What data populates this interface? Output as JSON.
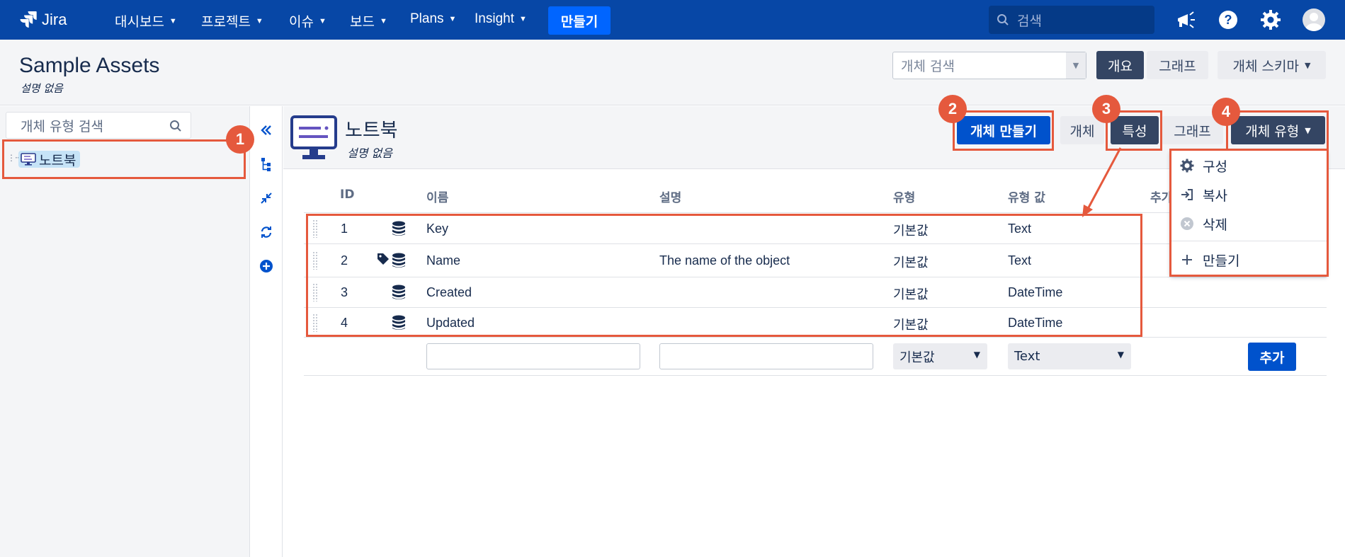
{
  "topnav": {
    "logo_text": "Jira",
    "items": [
      "대시보드",
      "프로젝트",
      "이슈",
      "보드",
      "Plans",
      "Insight"
    ],
    "create_label": "만들기",
    "search_placeholder": "검색",
    "icons": [
      "megaphone-icon",
      "help-icon",
      "settings-icon",
      "avatar"
    ]
  },
  "subheader": {
    "title": "Sample Assets",
    "subtitle": "설명 없음",
    "object_search_placeholder": "개체 검색",
    "overview_label": "개요",
    "graph_label": "그래프",
    "schema_label": "개체 스키마"
  },
  "left_panel": {
    "search_placeholder": "개체 유형 검색",
    "tree_items": [
      "노트북"
    ]
  },
  "type_header": {
    "title": "노트북",
    "subtitle": "설명 없음",
    "create_object_label": "개체 만들기",
    "objects_label": "개체",
    "attributes_label": "특성",
    "graph_label": "그래프",
    "object_type_label": "개체 유형"
  },
  "table": {
    "headers": [
      "ID",
      "이름",
      "설명",
      "유형",
      "유형 값",
      "추가"
    ],
    "rows": [
      {
        "id": "1",
        "name": "Key",
        "description": "",
        "type": "기본값",
        "type_value": "Text"
      },
      {
        "id": "2",
        "name": "Name",
        "description": "The name of the object",
        "type": "기본값",
        "type_value": "Text"
      },
      {
        "id": "3",
        "name": "Created",
        "description": "",
        "type": "기본값",
        "type_value": "DateTime"
      },
      {
        "id": "4",
        "name": "Updated",
        "description": "",
        "type": "기본값",
        "type_value": "DateTime"
      }
    ],
    "new_row": {
      "type_select": "기본값",
      "type_value_select": "Text",
      "add_label": "추가"
    }
  },
  "dropdown": {
    "items": [
      "구성",
      "복사",
      "삭제",
      "만들기"
    ]
  },
  "annotations": {
    "badges": [
      "1",
      "2",
      "3",
      "4"
    ],
    "color": "#e5593d"
  },
  "colors": {
    "nav_bg": "#0747a6",
    "primary": "#0052cc",
    "dark_button": "#344563"
  }
}
